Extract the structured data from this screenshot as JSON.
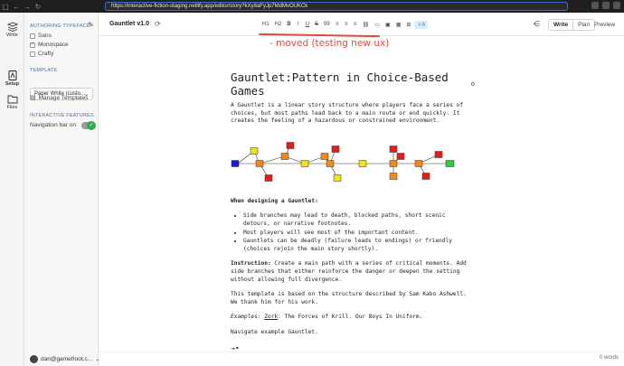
{
  "browser": {
    "url": "https://interactive-fiction-staging.netlify.app/editor/story?kXy8aFyJp7MdMvOUKCk"
  },
  "rail": {
    "items": [
      {
        "label": "Write",
        "icon": "stack-icon"
      },
      {
        "label": "Setup",
        "icon": "setup-icon"
      },
      {
        "label": "Files",
        "icon": "folder-icon"
      }
    ]
  },
  "sidebar": {
    "typeface_heading": "AUTHORING TYPEFACE",
    "typefaces": [
      {
        "label": "Sans",
        "checked": false
      },
      {
        "label": "Monospace",
        "checked": true
      },
      {
        "label": "Crafty",
        "checked": false
      }
    ],
    "template_heading": "TEMPLATE",
    "template_value": "Paper White (custo...",
    "manage_templates": "Manage Templates",
    "features_heading": "INTERACTIVE FEATURES",
    "navbar_label": "Navigation bar on",
    "navbar_on": true,
    "user": "dan@gamefroot.c..."
  },
  "topbar": {
    "title": "Gauntlet v1.0",
    "toolbar": [
      "H1",
      "H2",
      "B",
      "I",
      "U",
      "S",
      "99",
      "≡",
      "≡",
      "≡",
      "⛓",
      "▭",
      "▣",
      "▦",
      "⊞",
      "✧A"
    ],
    "modes": [
      "Write",
      "Plan"
    ],
    "preview": "Preview"
  },
  "annotation": "- moved (testing new ux)",
  "doc": {
    "title": "Gauntlet:Pattern in Choice-Based Games",
    "intro": "A Gauntlet is a linear story structure where players face a series of choices, but most paths lead back to a main route or end quickly. It creates the feeling of a hazardous or constrained environment.",
    "designing_heading": "When designing a Gauntlet:",
    "bullets": [
      "Side branches may lead to death, blocked paths, short scenic detours, or narrative footnotes.",
      "Most players will see most of the important content.",
      "Gauntlets can be deadly (failure leads to endings) or friendly (choices rejoin the main story shortly)."
    ],
    "instruction_label": "Instruction:",
    "instruction_text": " Create a main path with a series of critical moments. Add side branches that either reinforce the danger or deepen the setting without allowing full divergence.",
    "attribution": "This template is based on the structure described by Sam Kabo Ashwell. We thank him for his work.",
    "examples_label": "Examples:",
    "examples_zork": "Zork",
    "examples_rest": ": The Forces of Krill. Our Boys In Uniform.",
    "navigate": "Navigate example Gauntlet.",
    "colors": {
      "start": "#1a1ad6",
      "main": "#f08a1c",
      "death": "#e01e1e",
      "side": "#f2e21a",
      "end": "#2ecc40"
    }
  },
  "status": {
    "wordcount": "0 words"
  }
}
